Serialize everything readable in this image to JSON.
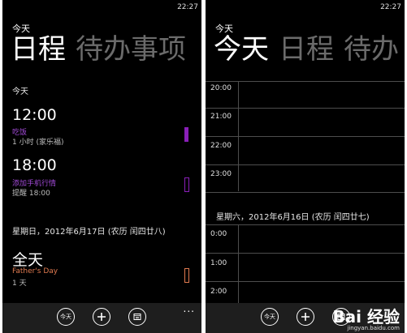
{
  "status": {
    "time": "22:27"
  },
  "left": {
    "app_title": "今天",
    "pivot": {
      "active": "日程",
      "next": "待办事项"
    },
    "section_today": "今天",
    "events": [
      {
        "time": "12:00",
        "title": "吃饭",
        "subtitle": "1 小时 (家乐福)",
        "color": "#8a1fb8"
      },
      {
        "time": "18:00",
        "title": "添加手机行情",
        "subtitle": "提醒 18:00",
        "color": "#8a1fb8"
      }
    ],
    "day_header": "星期日，2012年6月17日 (农历 闰四廿八)",
    "allday": {
      "label": "全天",
      "title": "Father's Day",
      "subtitle": "1 天",
      "color": "#e07a50"
    }
  },
  "right": {
    "app_title": "今天",
    "pivot": {
      "active": "今天",
      "second": "日程",
      "third": "待办"
    },
    "hours_top": [
      "20:00",
      "21:00",
      "22:00",
      "23:00"
    ],
    "day_header": "星期六，2012年6月16日 (农历 闰四廿七)",
    "hours_bottom": [
      "0:00",
      "1:00",
      "2:00"
    ]
  },
  "appbar": {
    "today_label": "今天",
    "more": "..."
  },
  "watermark": {
    "logo": "Bai 经验",
    "url": "jingyan.baidu.com"
  }
}
